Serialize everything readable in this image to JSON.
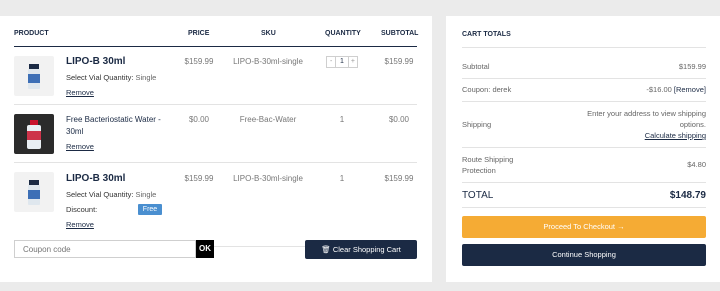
{
  "cart": {
    "headers": {
      "product": "PRODUCT",
      "price": "PRICE",
      "sku": "SKU",
      "quantity": "QUANTITY",
      "subtotal": "SUBTOTAL"
    },
    "items": [
      {
        "name": "LIPO-B 30ml",
        "meta_label": "Select Vial Quantity:",
        "meta_value": "Single",
        "price": "$159.99",
        "sku": "LIPO-B-30ml-single",
        "quantity": "1",
        "qty_minus": "-",
        "qty_plus": "+",
        "subtotal": "$159.99",
        "remove": "Remove",
        "thumb_icon": "vial-icon"
      },
      {
        "name": "Free Bacteriostatic Water - 30ml",
        "price": "$0.00",
        "sku": "Free-Bac-Water",
        "quantity": "1",
        "subtotal": "$0.00",
        "remove": "Remove",
        "thumb_icon": "water-bottle-icon"
      },
      {
        "name": "LIPO-B 30ml",
        "meta_label": "Select Vial Quantity:",
        "meta_value": "Single",
        "discount_label": "Discount:",
        "discount_badge": "Free",
        "price": "$159.99",
        "sku": "LIPO-B-30ml-single",
        "quantity": "1",
        "subtotal": "$159.99",
        "remove": "Remove",
        "thumb_icon": "vial-icon"
      }
    ],
    "coupon_placeholder": "Coupon code",
    "apply_label": "OK",
    "clear_label": "Clear Shopping Cart",
    "clear_icon": "trash-icon"
  },
  "totals": {
    "title": "CART TOTALS",
    "subtotal_label": "Subtotal",
    "subtotal_value": "$159.99",
    "coupon_label": "Coupon: derek",
    "coupon_value": "-$16.00",
    "coupon_remove": "[Remove]",
    "shipping_label": "Shipping",
    "shipping_text": "Enter your address to view shipping options.",
    "shipping_link": "Calculate shipping",
    "route_label": "Route Shipping Protection",
    "route_value": "$4.80",
    "total_label": "TOTAL",
    "total_value": "$148.79",
    "checkout_label": "Proceed To Checkout →",
    "continue_label": "Continue Shopping"
  },
  "colors": {
    "navy": "#1b2a44",
    "orange": "#f5ab34",
    "badge_blue": "#4a8fd0"
  }
}
